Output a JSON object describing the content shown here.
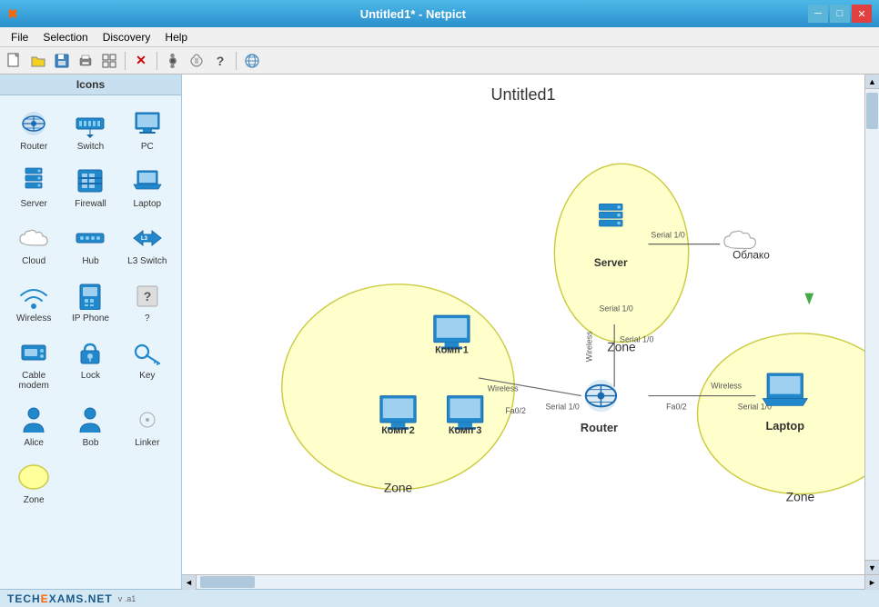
{
  "titleBar": {
    "title": "Untitled1* - Netpict",
    "icon": "✖",
    "minimizeLabel": "─",
    "maximizeLabel": "□",
    "closeLabel": "✕"
  },
  "menuBar": {
    "items": [
      "File",
      "Selection",
      "Discovery",
      "Help"
    ]
  },
  "toolbar": {
    "buttons": [
      {
        "name": "new",
        "icon": "📄"
      },
      {
        "name": "open",
        "icon": "📂"
      },
      {
        "name": "save",
        "icon": "💾"
      },
      {
        "name": "print",
        "icon": "🖨"
      },
      {
        "name": "grid",
        "icon": "▦"
      },
      {
        "name": "delete",
        "icon": "✕",
        "red": true
      },
      {
        "name": "settings",
        "icon": "🔧"
      },
      {
        "name": "properties",
        "icon": "🔩"
      },
      {
        "name": "help",
        "icon": "?"
      },
      {
        "name": "internet",
        "icon": "🌐"
      }
    ]
  },
  "iconPanel": {
    "title": "Icons",
    "items": [
      {
        "id": "router",
        "label": "Router"
      },
      {
        "id": "switch",
        "label": "Switch"
      },
      {
        "id": "pc",
        "label": "PC"
      },
      {
        "id": "server",
        "label": "Server"
      },
      {
        "id": "firewall",
        "label": "Firewall"
      },
      {
        "id": "laptop",
        "label": "Laptop"
      },
      {
        "id": "cloud",
        "label": "Cloud"
      },
      {
        "id": "hub",
        "label": "Hub"
      },
      {
        "id": "l3switch",
        "label": "L3 Switch"
      },
      {
        "id": "wireless",
        "label": "Wireless"
      },
      {
        "id": "ipphone",
        "label": "IP Phone"
      },
      {
        "id": "unknown",
        "label": "?"
      },
      {
        "id": "cablemodem",
        "label": "Cable modem"
      },
      {
        "id": "lock",
        "label": "Lock"
      },
      {
        "id": "key",
        "label": "Key"
      },
      {
        "id": "alice",
        "label": "Alice"
      },
      {
        "id": "bob",
        "label": "Bob"
      },
      {
        "id": "linker",
        "label": "Linker"
      },
      {
        "id": "zone",
        "label": "Zone"
      }
    ]
  },
  "canvas": {
    "title": "Untitled1"
  },
  "statusBar": {
    "brand": "TECHEXAMS",
    "brandHighlight": "E",
    "suffix": ".NET",
    "version": "v .a1"
  }
}
